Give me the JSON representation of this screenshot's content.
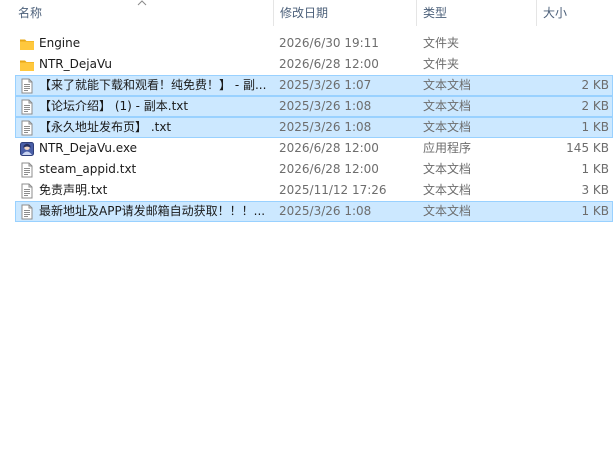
{
  "header": {
    "name": "名称",
    "date": "修改日期",
    "type": "类型",
    "size": "大小"
  },
  "files": [
    {
      "name": "Engine",
      "date": "2026/6/30 19:11",
      "type": "文件夹",
      "size": "",
      "icon": "folder-icon",
      "selected": false
    },
    {
      "name": "NTR_DejaVu",
      "date": "2026/6/28 12:00",
      "type": "文件夹",
      "size": "",
      "icon": "folder-icon",
      "selected": false
    },
    {
      "name": "【来了就能下载和观看！纯免费！】 - 副...",
      "date": "2025/3/26 1:07",
      "type": "文本文档",
      "size": "2 KB",
      "icon": "text-file-icon",
      "selected": true
    },
    {
      "name": "【论坛介绍】 (1) - 副本.txt",
      "date": "2025/3/26 1:08",
      "type": "文本文档",
      "size": "2 KB",
      "icon": "text-file-icon",
      "selected": true
    },
    {
      "name": "【永久地址发布页】 .txt",
      "date": "2025/3/26 1:08",
      "type": "文本文档",
      "size": "1 KB",
      "icon": "text-file-icon",
      "selected": true
    },
    {
      "name": "NTR_DejaVu.exe",
      "date": "2026/6/28 12:00",
      "type": "应用程序",
      "size": "145 KB",
      "icon": "app-exe-icon",
      "selected": false
    },
    {
      "name": "steam_appid.txt",
      "date": "2026/6/28 12:00",
      "type": "文本文档",
      "size": "1 KB",
      "icon": "text-file-icon",
      "selected": false
    },
    {
      "name": "免责声明.txt",
      "date": "2025/11/12 17:26",
      "type": "文本文档",
      "size": "3 KB",
      "icon": "text-file-icon",
      "selected": false
    },
    {
      "name": "最新地址及APP请发邮箱自动获取！！！...",
      "date": "2025/3/26 1:08",
      "type": "文本文档",
      "size": "1 KB",
      "icon": "text-file-icon",
      "selected": true
    }
  ],
  "colors": {
    "selection_fill": "#cce8ff",
    "selection_border": "#99d1ff",
    "header_text": "#4c607a",
    "folder": "#ffc83d"
  }
}
